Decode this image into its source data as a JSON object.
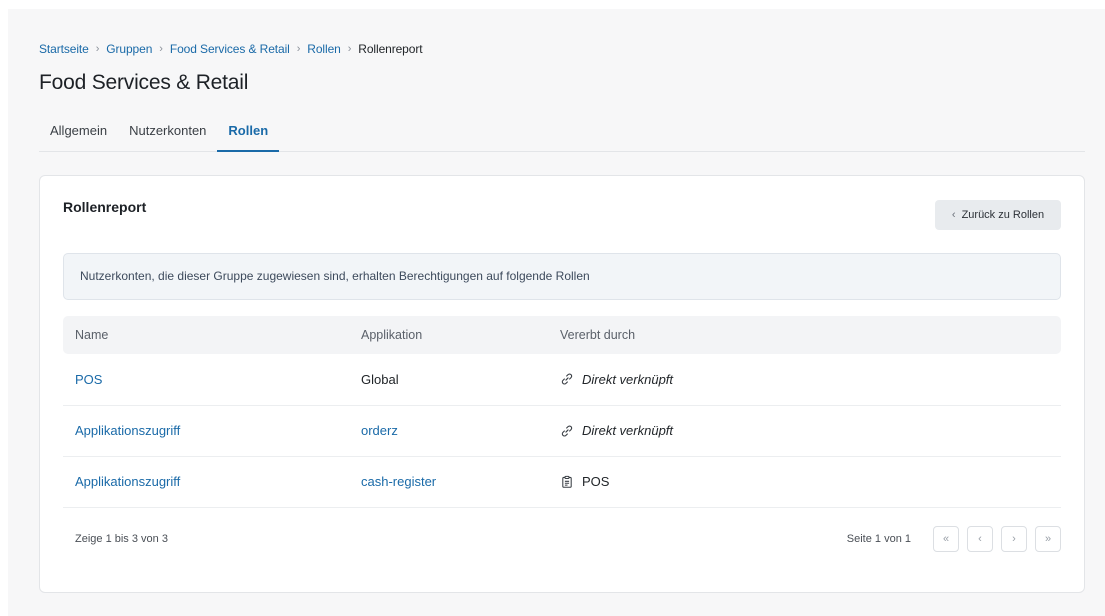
{
  "breadcrumb": {
    "items": [
      "Startseite",
      "Gruppen",
      "Food Services & Retail",
      "Rollen"
    ],
    "current": "Rollenreport"
  },
  "page_title": "Food Services & Retail",
  "tabs": [
    {
      "label": "Allgemein",
      "active": false
    },
    {
      "label": "Nutzerkonten",
      "active": false
    },
    {
      "label": "Rollen",
      "active": true
    }
  ],
  "card": {
    "title": "Rollenreport",
    "back_button": "Zurück zu Rollen",
    "info": "Nutzerkonten, die dieser Gruppe zugewiesen sind, erhalten Berechtigungen auf folgende Rollen"
  },
  "table": {
    "headers": [
      "Name",
      "Applikation",
      "Vererbt durch"
    ],
    "rows": [
      {
        "name": "POS",
        "application": "Global",
        "app_is_link": false,
        "via": "Direkt verknüpft",
        "via_icon": "link-icon"
      },
      {
        "name": "Applikationszugriff",
        "application": "orderz",
        "app_is_link": true,
        "via": "Direkt verknüpft",
        "via_icon": "link-icon"
      },
      {
        "name": "Applikationszugriff",
        "application": "cash-register",
        "app_is_link": true,
        "via": "POS",
        "via_icon": "clipboard-icon"
      }
    ]
  },
  "footer": {
    "count": "Zeige 1 bis 3 von 3",
    "page_info": "Seite 1 von 1"
  },
  "colors": {
    "accent": "#1a6aa8",
    "page_bg": "#f7f7f8",
    "info_bg": "#f2f5f8"
  }
}
